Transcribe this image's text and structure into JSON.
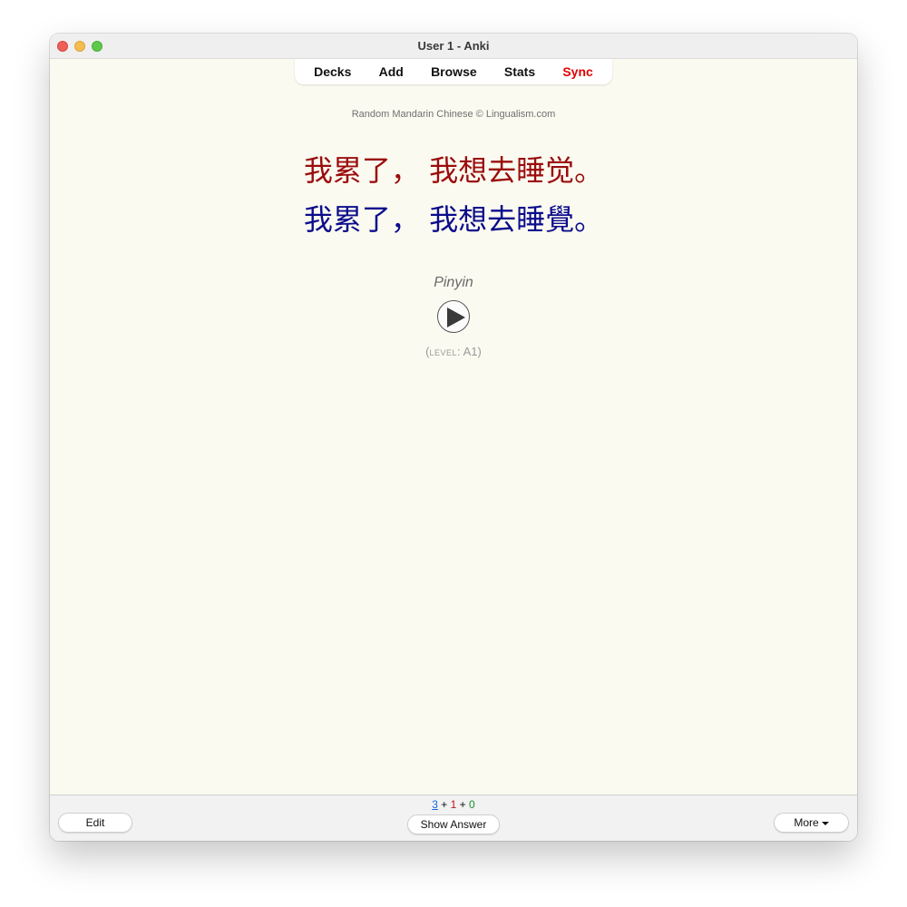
{
  "window": {
    "title": "User 1 - Anki"
  },
  "toolbar": {
    "decks": "Decks",
    "add": "Add",
    "browse": "Browse",
    "stats": "Stats",
    "sync": "Sync",
    "sync_color": "#e30000"
  },
  "card": {
    "source": "Random Mandarin Chinese © Lingualism.com",
    "simplified": "我累了， 我想去睡觉。",
    "traditional": "我累了， 我想去睡覺。",
    "pinyin": "Pinyin",
    "level_open": "(",
    "level_label": "level",
    "level_sep": ": ",
    "level_value": "A1",
    "level_close": ")",
    "simplified_color": "#9b0c0c",
    "traditional_color": "#0c0c8c",
    "play_icon": "play-icon"
  },
  "bottom": {
    "edit_label": "Edit",
    "show_answer_label": "Show Answer",
    "more_label": "More",
    "count_new": "3",
    "count_sep1": " + ",
    "count_learn": "1",
    "count_sep2": " + ",
    "count_review": "0",
    "count_colors": {
      "new": "#1565d8",
      "learn": "#c0141b",
      "review": "#16912b"
    }
  }
}
